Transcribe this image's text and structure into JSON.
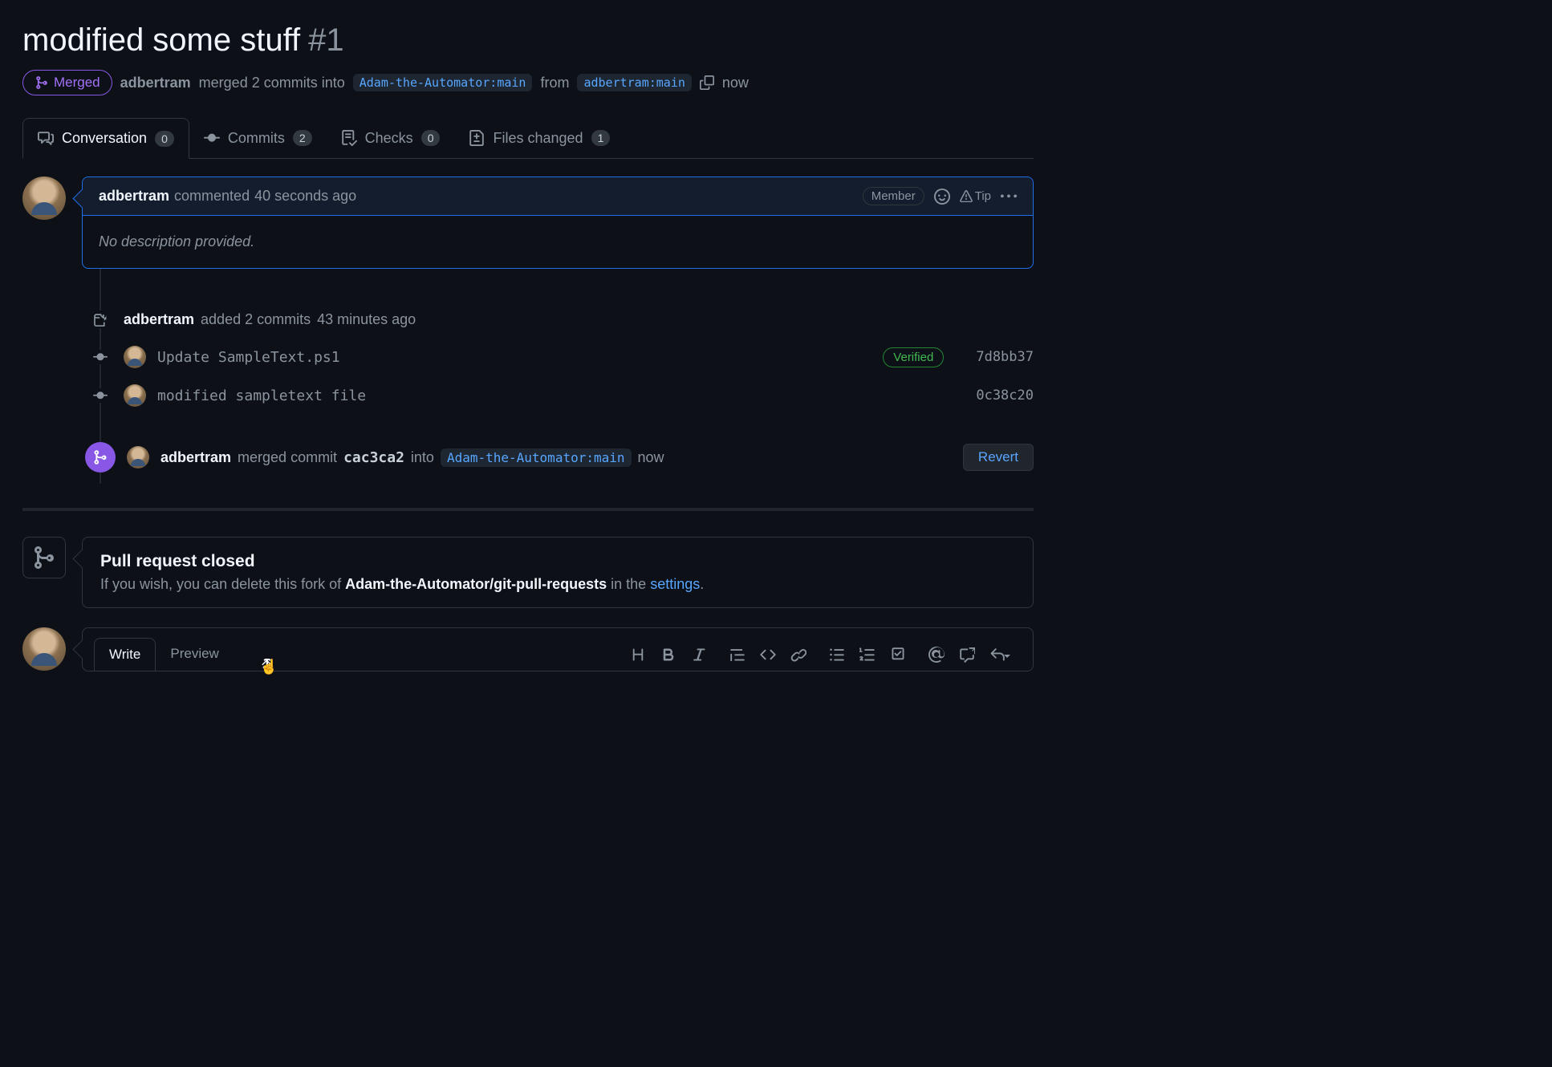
{
  "pr": {
    "title": "modified some stuff",
    "number": "#1",
    "status": "Merged",
    "author": "adbertram",
    "meta_text_1": "merged 2 commits into",
    "base_branch": "Adam-the-Automator:main",
    "meta_text_2": "from",
    "head_branch": "adbertram:main",
    "merged_time": "now"
  },
  "tabs": {
    "conversation": {
      "label": "Conversation",
      "count": "0"
    },
    "commits": {
      "label": "Commits",
      "count": "2"
    },
    "checks": {
      "label": "Checks",
      "count": "0"
    },
    "files": {
      "label": "Files changed",
      "count": "1"
    }
  },
  "comment": {
    "author": "adbertram",
    "action": "commented",
    "time": "40 seconds ago",
    "member_label": "Member",
    "tip_label": "Tip",
    "body": "No description provided."
  },
  "push_event": {
    "user": "adbertram",
    "text": "added 2 commits",
    "time": "43 minutes ago"
  },
  "commits": [
    {
      "message": "Update SampleText.ps1",
      "verified": "Verified",
      "sha": "7d8bb37"
    },
    {
      "message": "modified sampletext file",
      "verified": "",
      "sha": "0c38c20"
    }
  ],
  "merge_event": {
    "user": "adbertram",
    "text_1": "merged commit",
    "sha": "cac3ca2",
    "text_2": "into",
    "branch": "Adam-the-Automator:main",
    "time": "now",
    "revert_label": "Revert"
  },
  "closed": {
    "title": "Pull request closed",
    "text_1": "If you wish, you can delete this fork of ",
    "repo": "Adam-the-Automator/git-pull-requests",
    "text_2": " in the ",
    "link": "settings",
    "text_3": "."
  },
  "form": {
    "write_tab": "Write",
    "preview_tab": "Preview"
  }
}
